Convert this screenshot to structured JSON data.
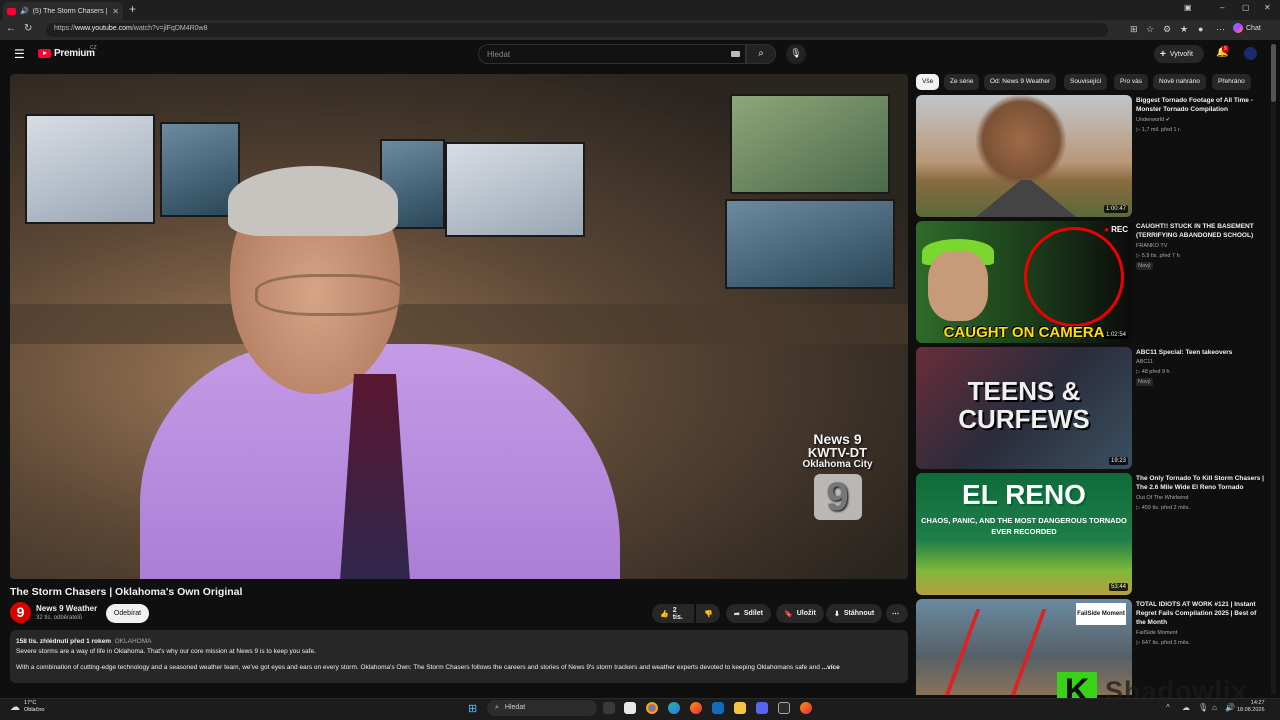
{
  "browser": {
    "tab_title": "(5) The Storm Chasers | Okla…",
    "url_prefix": "https://",
    "url_host": "www.youtube.com",
    "url_path": "/watch?v=jlFqDM4R0w8",
    "chat_label": "Chat"
  },
  "masthead": {
    "logo_text": "Premium",
    "logo_cc": "CZ",
    "search_placeholder": "Hledat",
    "create_label": "Vytvořit",
    "notif_count": "9"
  },
  "player": {
    "watermark_line1": "News 9",
    "watermark_line2": "KWTV-DT",
    "watermark_line3": "Oklahoma City",
    "watermark_logo": "9"
  },
  "video": {
    "title": "The Storm Chasers | Oklahoma's Own Original",
    "channel_initial": "9",
    "channel_name": "News 9 Weather",
    "subscribers": "32 tis. odběratelů",
    "subscribe_label": "Odebírat",
    "likes": "2 tis.",
    "share_label": "Sdílet",
    "save_label": "Uložit",
    "download_label": "Stáhnout",
    "views_date": "158 tis. zhlédnutí  před 1 rokem",
    "tag": "OKLAHOMA",
    "desc_line1": "Severe storms are a way of life in Oklahoma. That's why our core mission at News 9 is to keep you safe.",
    "desc_line2": "With a combination of cutting-edge technology and a seasoned weather team, we've got eyes and ears on every storm. Oklahoma's Own: The Storm Chasers follows the careers and stories of News 9's storm trackers and weather experts devoted to keeping Oklahomans safe and",
    "more_label": "...více"
  },
  "chips": [
    "Vše",
    "Ze série",
    "Od: News 9 Weather",
    "Související",
    "Pro vás",
    "Nově nahráno",
    "Přehráno"
  ],
  "recommendations": [
    {
      "title": "Biggest Tornado Footage of All Time - Monster Tornado Compilation",
      "channel": "Underworld",
      "meta": "▷ 1,7 mil.  před 1 r.",
      "duration": "1:00:47",
      "badge": ""
    },
    {
      "title": "CAUGHT!! STUCK IN THE BASEMENT (TERRIFYING ABANDONED SCHOOL)",
      "channel": "FRANKO TV",
      "meta": "▷ 5,9 tis.  před 7 h",
      "duration": "1:02:54",
      "badge": "Nový",
      "thumb_text": "CAUGHT ON CAMERA",
      "rec_text": "REC"
    },
    {
      "title": "ABC11 Special: Teen takeovers",
      "channel": "ABC11",
      "meta": "▷ 48  před 9 h",
      "duration": "19:23",
      "badge": "Nový",
      "thumb_text": "TEENS & CURFEWS"
    },
    {
      "title": "The Only Tornado To Kill Storm Chasers | The 2.6 Mile Wide El Reno Tornado",
      "channel": "Out Of The Whirlwind",
      "meta": "▷ 459 tis.  před 2 měs.",
      "duration": "53:44",
      "badge": "",
      "thumb_text": "EL RENO",
      "thumb_sub": "CHAOS, PANIC, AND THE MOST DANGEROUS TORNADO EVER RECORDED"
    },
    {
      "title": "TOTAL IDIOTS AT WORK #121 | Instant Regret Fails Compilation 2025 | Best of the Month",
      "channel": "FailSide Moment",
      "meta": "▷ 647 tis.  před 3 měs.",
      "duration": "",
      "badge": "",
      "thumb_text": "FailSide Moment"
    }
  ],
  "overlay": {
    "logo": "K",
    "text": "Shadowlix"
  },
  "taskbar": {
    "temp": "17°C",
    "condition": "Oblačno",
    "search_label": "Hledat",
    "time": "14:27",
    "date": "18.08.2026"
  },
  "colors": {
    "accent_red": "#ff0033",
    "bg": "#0f0f0f",
    "chip_bg": "#272727"
  }
}
